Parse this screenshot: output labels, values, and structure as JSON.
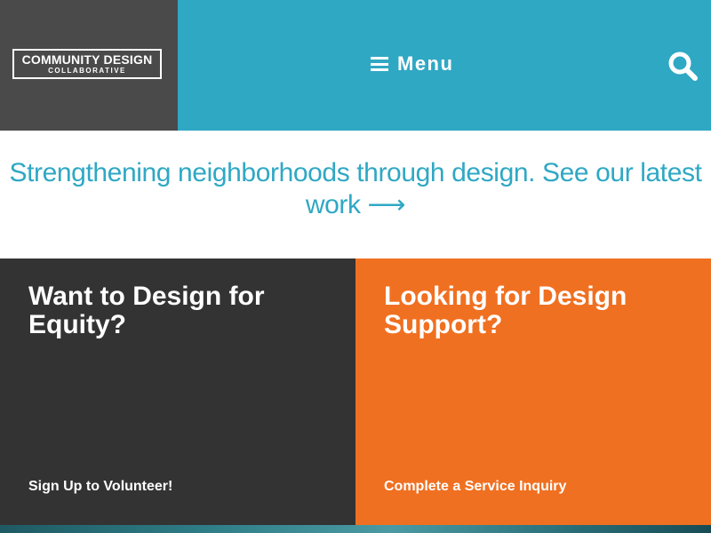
{
  "header": {
    "logo": {
      "title": "COMMUNITY DESIGN",
      "subtitle": "COLLABORATIVE"
    },
    "menu_label": "Menu",
    "icons": {
      "menu": "hamburger-icon",
      "search": "search-icon"
    }
  },
  "tagline": {
    "text": "Strengthening neighborhoods through design. See our latest work ⟶"
  },
  "panels": [
    {
      "heading": "Want to Design for Equity?",
      "link": "Sign Up to Volunteer!"
    },
    {
      "heading": "Looking for Design Support?",
      "link": "Complete a Service Inquiry"
    }
  ],
  "colors": {
    "header_blue": "#2fa8c4",
    "logo_gray": "#4a4a4a",
    "panel_dark": "#333333",
    "panel_orange": "#f07021"
  }
}
